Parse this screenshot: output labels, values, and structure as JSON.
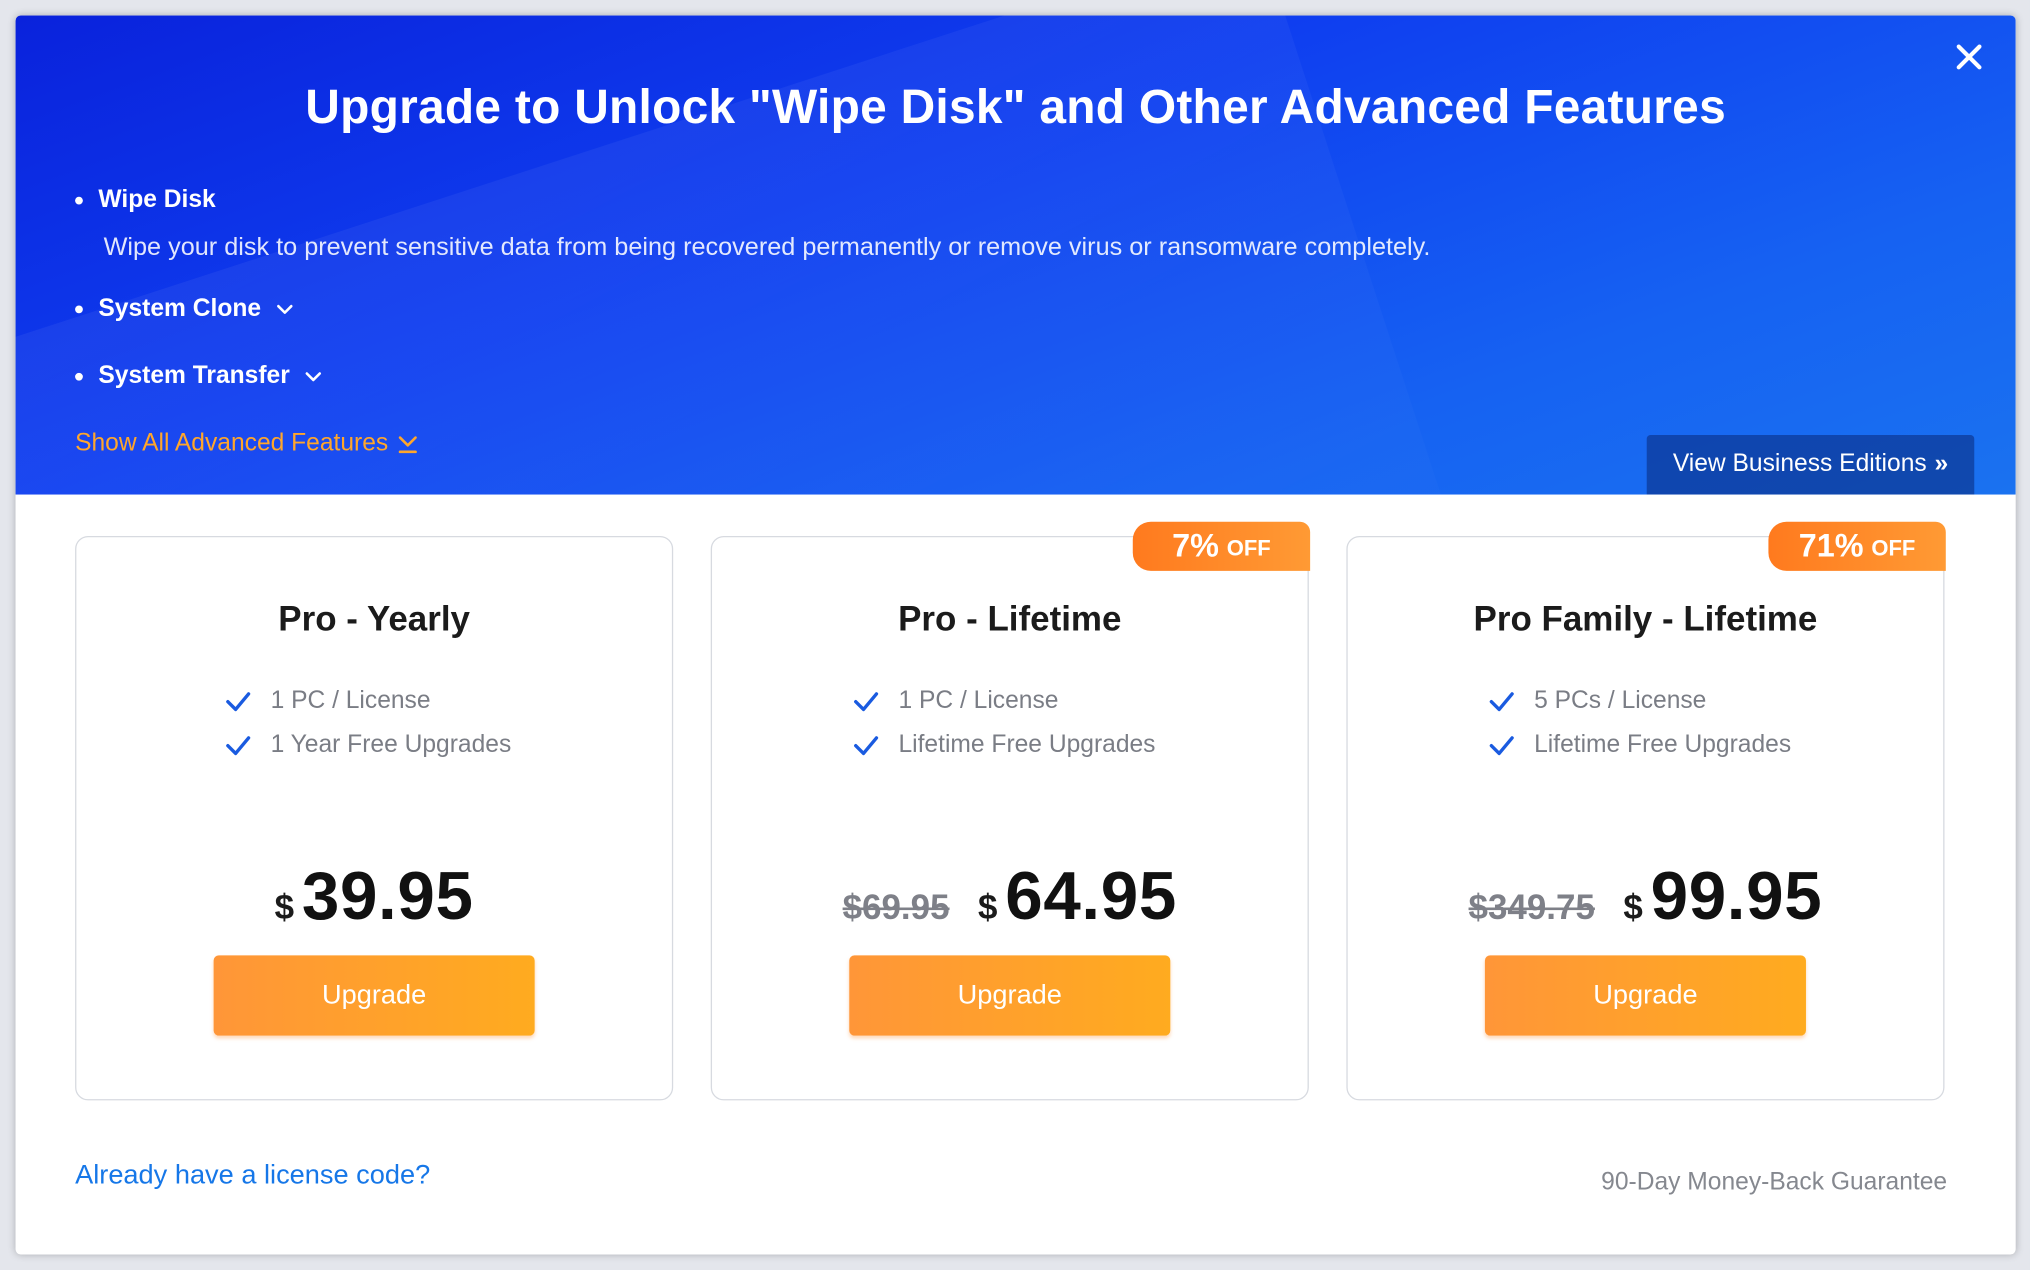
{
  "dialog": {
    "title": "Upgrade to Unlock \"Wipe Disk\" and Other Advanced Features",
    "close_icon": "close-icon"
  },
  "features": [
    {
      "name": "Wipe Disk",
      "description": "Wipe your disk to prevent sensitive data from being recovered permanently or remove virus or ransomware completely.",
      "expanded": true
    },
    {
      "name": "System Clone",
      "expanded": false
    },
    {
      "name": "System Transfer",
      "expanded": false
    }
  ],
  "show_all_label": "Show All Advanced Features",
  "business_button_label": "View Business Editions",
  "plans": [
    {
      "title": "Pro - Yearly",
      "features": [
        "1 PC / License",
        "1 Year Free Upgrades"
      ],
      "currency": "$",
      "price": "39.95",
      "old_price": "",
      "badge_percent": "",
      "badge_off": "",
      "button_label": "Upgrade"
    },
    {
      "title": "Pro - Lifetime",
      "features": [
        "1 PC / License",
        "Lifetime Free Upgrades"
      ],
      "currency": "$",
      "price": "64.95",
      "old_price": "$69.95",
      "badge_percent": "7%",
      "badge_off": "OFF",
      "button_label": "Upgrade"
    },
    {
      "title": "Pro Family - Lifetime",
      "features": [
        "5 PCs / License",
        "Lifetime Free Upgrades"
      ],
      "currency": "$",
      "price": "99.95",
      "old_price": "$349.75",
      "badge_percent": "71%",
      "badge_off": "OFF",
      "button_label": "Upgrade"
    }
  ],
  "footer": {
    "license_link": "Already have a license code?",
    "guarantee": "90-Day Money-Back Guarantee"
  },
  "colors": {
    "hero_blue": "#0f3ff0",
    "accent_orange": "#ffa62b",
    "check_blue": "#1a5be0",
    "link_blue": "#1677e8"
  }
}
